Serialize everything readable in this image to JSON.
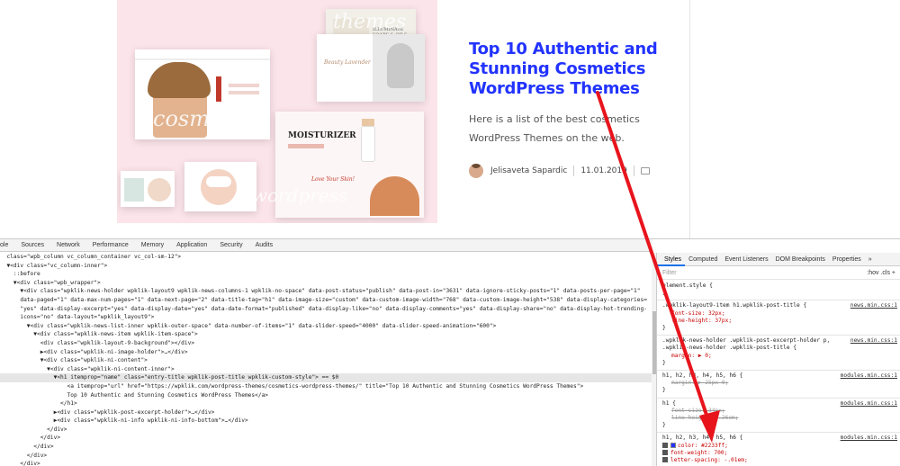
{
  "post": {
    "title": "Top 10 Authentic and Stunning Cosmetics WordPress Themes",
    "excerpt": "Here is a list of the best cosmetics WordPress Themes on the web.",
    "author": "Jelisaveta Sapardic",
    "date": "11.01.2019"
  },
  "hero": {
    "words": [
      "themes",
      "cosmetics",
      "wordpress"
    ],
    "mock_texts": [
      "MOISTURIZER",
      "Love Your Skin!",
      "ILLUMINATE SOAPS & OILS",
      "Beauty Lavender"
    ]
  },
  "devtools": {
    "tabs": [
      "ole",
      "Sources",
      "Network",
      "Performance",
      "Memory",
      "Application",
      "Security",
      "Audits"
    ],
    "side_tabs": [
      "Styles",
      "Computed",
      "Event Listeners",
      "DOM Breakpoints",
      "Properties",
      "»"
    ],
    "filter_placeholder": "Filter",
    "filter_tools": ":hov  .cls  +",
    "rules": [
      {
        "selector": "element.style {",
        "lines": [
          "}"
        ],
        "source": ""
      },
      {
        "selector": ".wpklik-layout9-item h1.wpklik-post-title {",
        "lines": [
          "font-size: 32px;",
          "line-height: 37px;",
          "}"
        ],
        "source": "news.min.css:1"
      },
      {
        "selector": ".wpklik-news-holder .wpklik-post-excerpt-holder p,",
        "selector2": ".wpklik-news-holder .wpklik-post-title {",
        "lines": [
          "margin: ▶ 0;",
          "}"
        ],
        "source": "news.min.css:1"
      },
      {
        "selector": "h1, h2, h3, h4, h5, h6 {",
        "lines": [
          "margin: ▶ 25px 0;",
          "}"
        ],
        "source": "modules.min.css:1"
      },
      {
        "selector": "h1 {",
        "lines": [
          "font-size: 34px;",
          "line-height: 1.26em;",
          "}"
        ],
        "source": "modules.min.css:1"
      },
      {
        "selector": "h1, h2, h3, h4, h5, h6 {",
        "lines": [
          "color: #2233ff;",
          "font-weight: 700;",
          "letter-spacing: -.01em;"
        ],
        "source": "modules.min.css:1"
      }
    ],
    "highlight_color": "#2233ff"
  },
  "elements_lines": [
    "  class=\"wpb_column vc_column_container vc_col-sm-12\">",
    "  ▼<div class=\"vc_column-inner\">",
    "    ::before",
    "    ▼<div class=\"wpb_wrapper\">",
    "      ▼<div class=\"wpklik-news-holder wpklik-layout9 wpklik-news-columns-1 wpklik-no-space\" data-post-status=\"publish\" data-post-in=\"3631\" data-ignore-sticky-posts=\"1\" data-posts-per-page=\"1\"",
    "      data-paged=\"1\" data-max-num-pages=\"1\" data-next-page=\"2\" data-title-tag=\"h1\" data-image-size=\"custom\" data-custom-image-width=\"768\" data-custom-image-height=\"538\" data-display-categories=",
    "      \"yes\" data-display-excerpt=\"yes\" data-display-date=\"yes\" data-date-format=\"published\" data-display-like=\"no\" data-display-comments=\"yes\" data-display-share=\"no\" data-display-hot-trending-",
    "      icons=\"no\" data-layout=\"wpklik_layout9\">",
    "        ▼<div class=\"wpklik-news-list-inner wpklik-outer-space\" data-number-of-items=\"1\" data-slider-speed=\"4000\" data-slider-speed-animation=\"600\">",
    "          ▼<div class=\"wpklik-news-item wpklik-item-space\">",
    "            <div class=\"wpklik-layout-9-background\"></div>",
    "            ▶<div class=\"wpklik-ni-image-holder\">…</div>",
    "            ▼<div class=\"wpklik-ni-content\">",
    "              ▼<div class=\"wpklik-ni-content-inner\">",
    "                ▼<h1 itemprop=\"name\" class=\"entry-title wpklik-post-title wpklik-custom-style\"> == $0",
    "                    <a itemprop=\"url\" href=\"https://wpklik.com/wordpress-themes/cosmetics-wordpress-themes/\" title=\"Top 10 Authentic and Stunning Cosmetics WordPress Themes\">",
    "                    Top 10 Authentic and Stunning Cosmetics WordPress Themes</a>",
    "                  </h1>",
    "                ▶<div class=\"wpklik-post-excerpt-holder\">…</div>",
    "                ▶<div class=\"wpklik-ni-info wpklik-ni-info-bottom\">…</div>",
    "              </div>",
    "            </div>",
    "          </div>",
    "        </div>",
    "      </div>",
    "    </div>",
    "  </div>"
  ]
}
